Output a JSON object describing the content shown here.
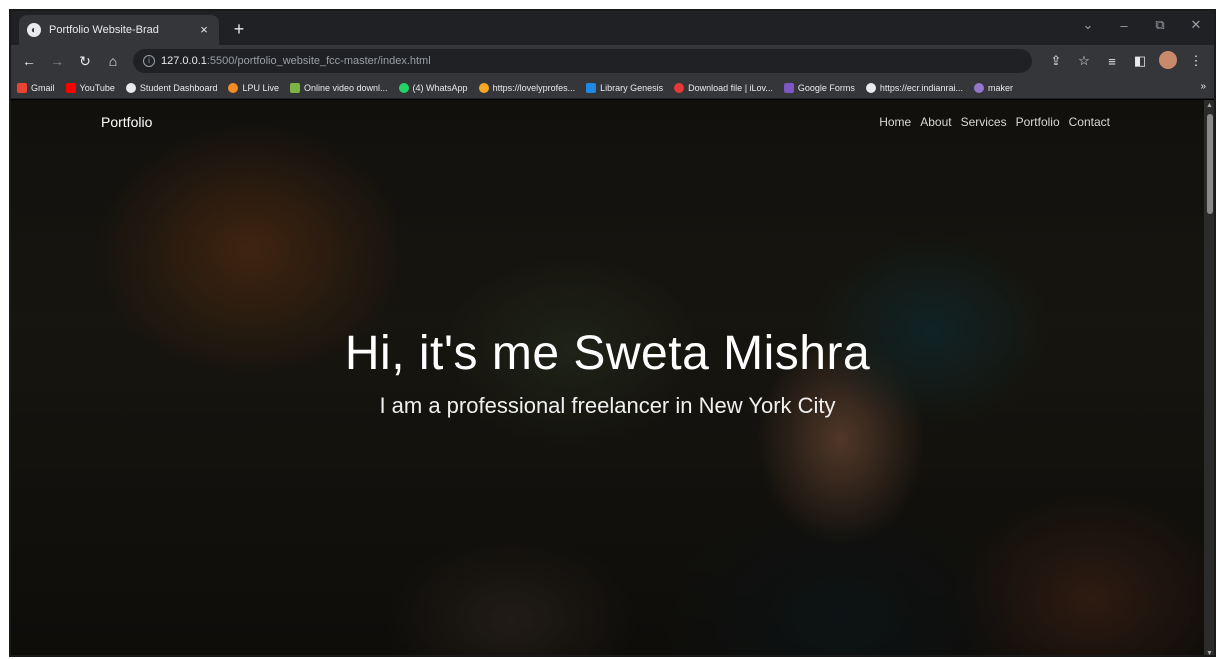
{
  "browser": {
    "tab_title": "Portfolio Website-Brad",
    "tab_close": "×",
    "new_tab": "+",
    "url_host": "127.0.0.1",
    "url_path": ":5500/portfolio_website_fcc-master/index.html",
    "window_controls": {
      "dropdown": "⌄",
      "minimize": "–",
      "restore": "⧉",
      "close": "✕"
    }
  },
  "bookmarks": [
    {
      "label": "Gmail",
      "color": "#ea4335"
    },
    {
      "label": "YouTube",
      "color": "#ff0000"
    },
    {
      "label": "Student Dashboard",
      "color": "#e8eaed"
    },
    {
      "label": "LPU Live",
      "color": "#f28b25"
    },
    {
      "label": "Online video downl...",
      "color": "#7cb342"
    },
    {
      "label": "(4) WhatsApp",
      "color": "#25d366"
    },
    {
      "label": "https://lovelyprofes...",
      "color": "#f9a825"
    },
    {
      "label": "Library Genesis",
      "color": "#1e88e5"
    },
    {
      "label": "Download file | iLov...",
      "color": "#e53935"
    },
    {
      "label": "Google Forms",
      "color": "#7e57c2"
    },
    {
      "label": "https://ecr.indianrai...",
      "color": "#e8eaed"
    },
    {
      "label": "maker",
      "color": "#9575cd"
    }
  ],
  "bookmarks_more": "»",
  "site": {
    "brand": "Portfolio",
    "menu": [
      "Home",
      "About",
      "Services",
      "Portfolio",
      "Contact"
    ],
    "hero_title": "Hi, it's me Sweta Mishra",
    "hero_subtitle": "I am a professional freelancer in New York City"
  }
}
